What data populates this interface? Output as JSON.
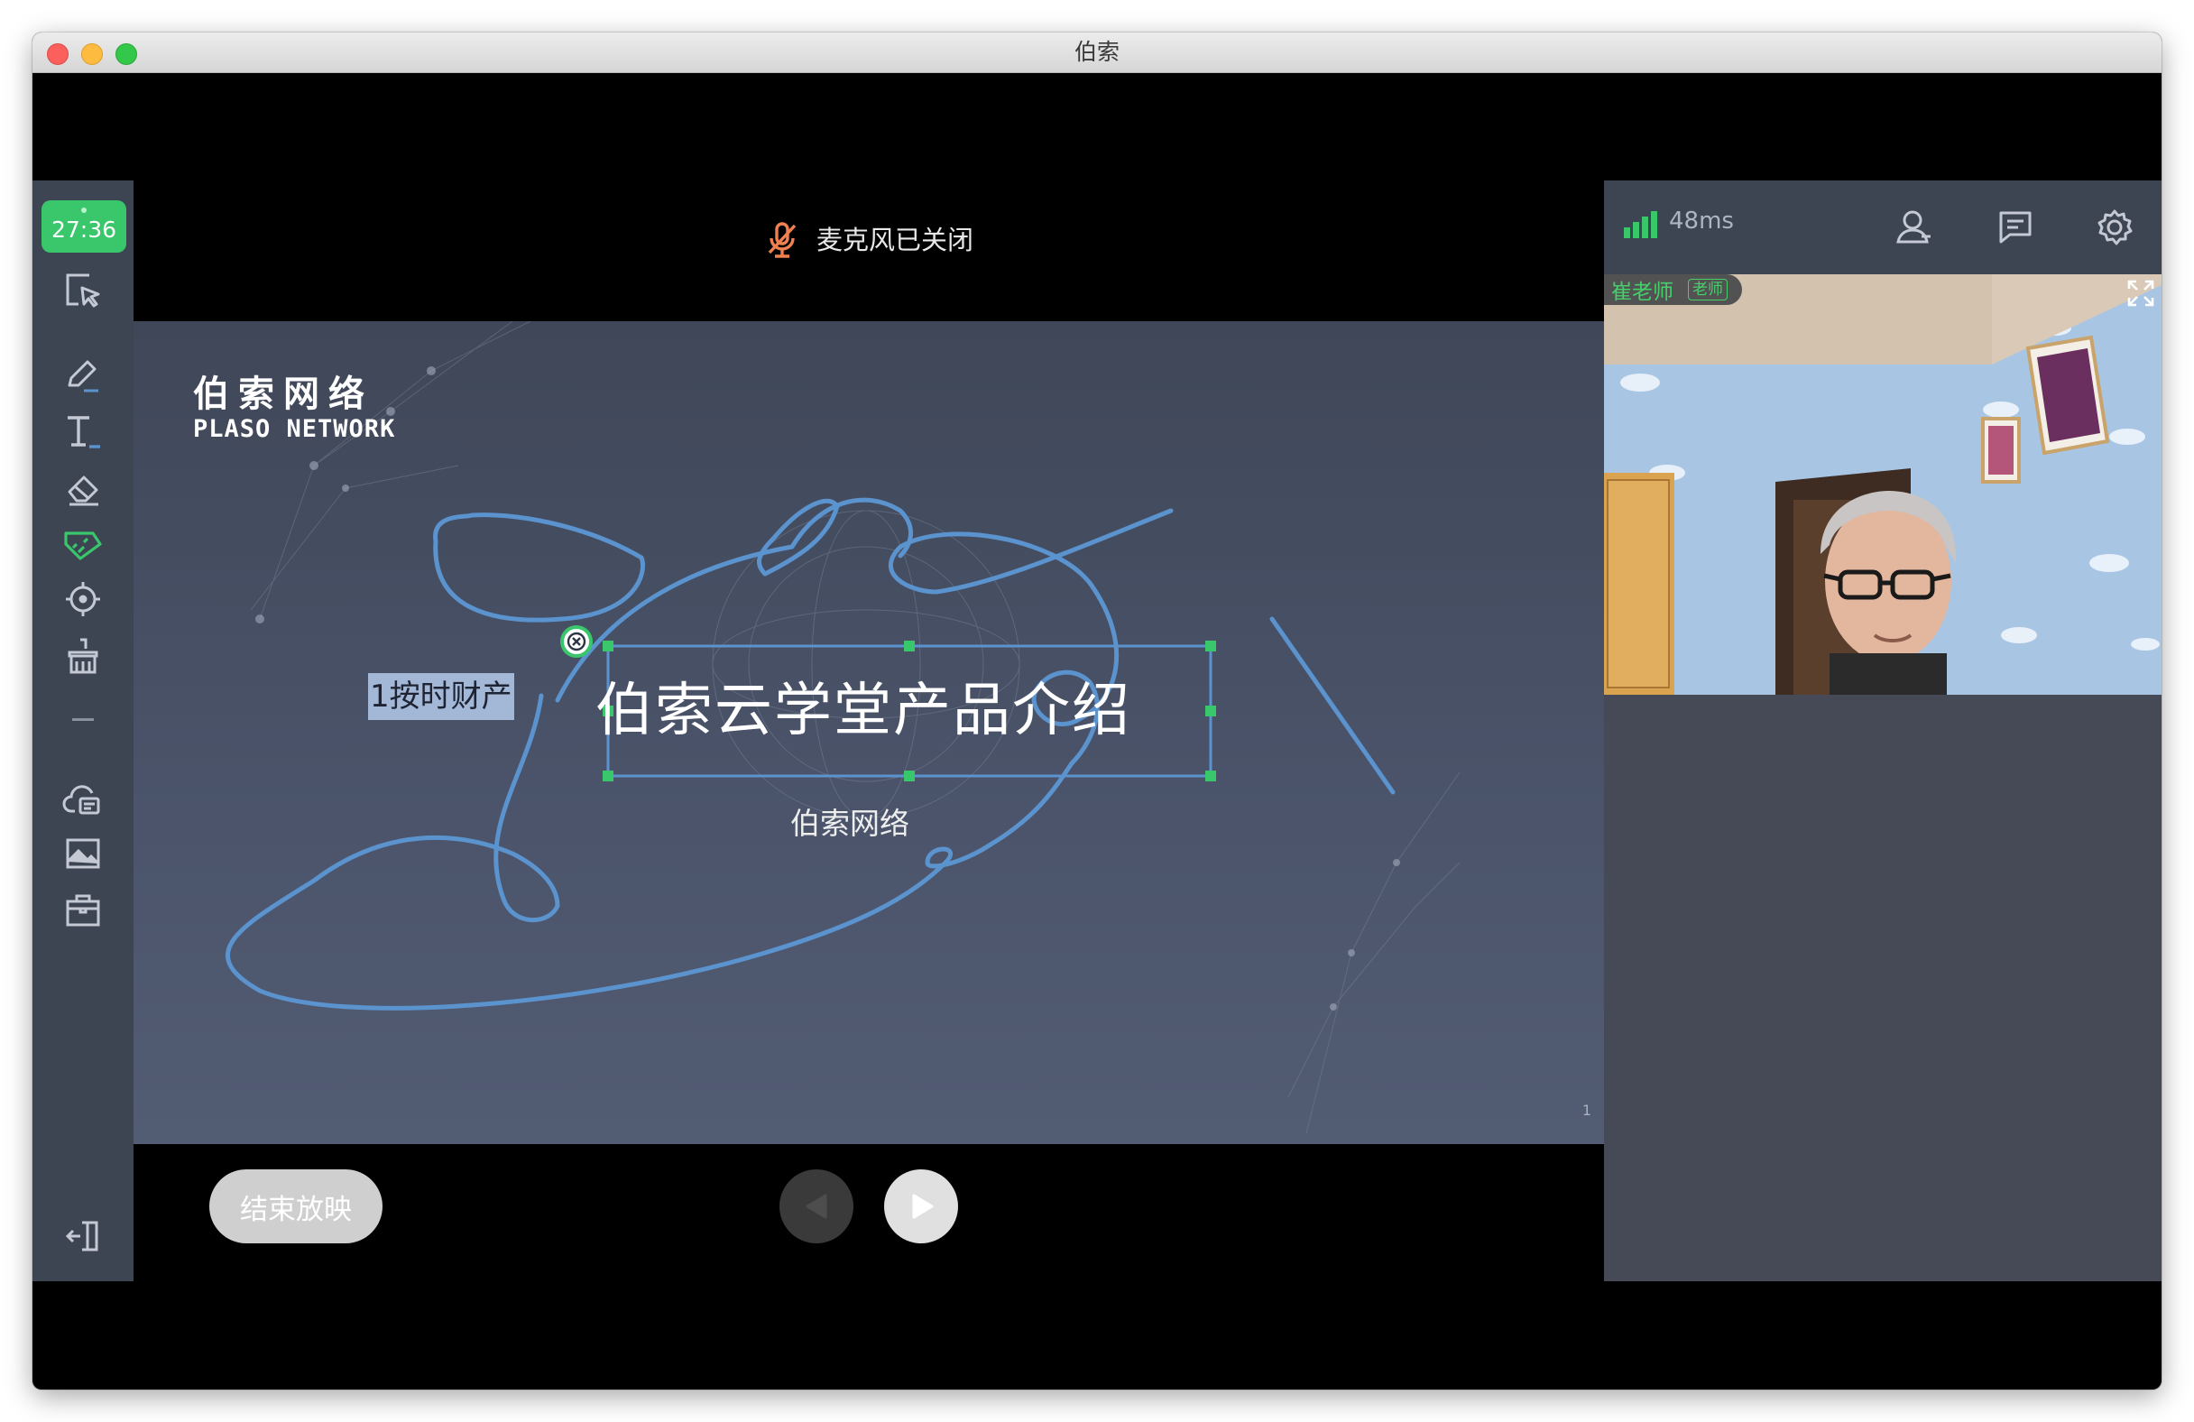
{
  "window": {
    "title": "伯索"
  },
  "toolbar": {
    "timer": "27:36",
    "tools": [
      {
        "name": "select-tool",
        "icon": "select-cursor-icon"
      },
      {
        "name": "pen-tool",
        "icon": "pen-icon"
      },
      {
        "name": "text-tool",
        "icon": "text-icon"
      },
      {
        "name": "eraser-tool",
        "icon": "eraser-icon"
      },
      {
        "name": "ruler-tool",
        "icon": "ruler-icon"
      },
      {
        "name": "laser-pointer-tool",
        "icon": "crosshair-icon"
      },
      {
        "name": "clear-tool",
        "icon": "broom-icon"
      },
      {
        "name": "cloud-files-tool",
        "icon": "cloud-doc-icon"
      },
      {
        "name": "image-tool",
        "icon": "image-icon"
      },
      {
        "name": "toolbox-tool",
        "icon": "toolbox-icon"
      },
      {
        "name": "exit-tool",
        "icon": "exit-icon"
      }
    ]
  },
  "status": {
    "mic": "麦克风已关闭"
  },
  "slide": {
    "brand_cn": "伯索网络",
    "brand_en": "PLASO NETWORK",
    "title": "伯索云学堂产品介绍",
    "subtitle": "伯索网络",
    "annotation_text": "1按时财产",
    "page_number": "1"
  },
  "controls": {
    "end_show": "结束放映"
  },
  "right_panel": {
    "latency": "48ms",
    "participant_name": "崔老师",
    "participant_role": "老师"
  },
  "colors": {
    "accent_green": "#3ac76b",
    "ink_blue": "#5b93cf",
    "toolbar_bg": "#3d4452",
    "mic_off_orange": "#f08050"
  }
}
